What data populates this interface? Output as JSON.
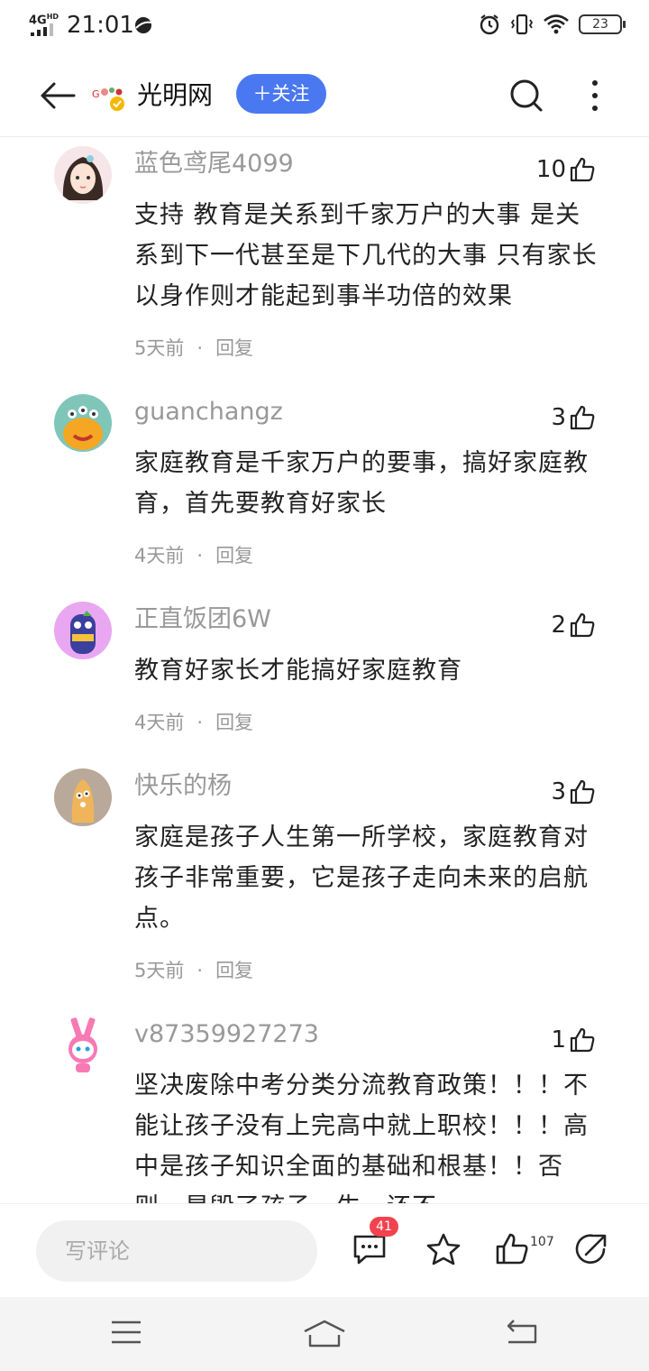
{
  "status_bar": {
    "network": "4G",
    "network_sup": "HD",
    "time": "21:01",
    "battery": "23"
  },
  "header": {
    "back_icon": "arrow-left-icon",
    "channel_name": "光明网",
    "follow_label": "＋关注",
    "search_icon": "search-icon",
    "more_icon": "more-vertical-icon"
  },
  "comments": [
    {
      "user": "蓝色鸢尾4099",
      "likes": "10",
      "text": "支持 教育是关系到千家万户的大事 是关系到下一代甚至是下几代的大事 只有家长以身作则才能起到事半功倍的效果",
      "time": "5天前",
      "reply": "回复",
      "avatar_color": "#f6e6ea"
    },
    {
      "user": "guanchangz",
      "likes": "3",
      "text": "家庭教育是千家万户的要事，搞好家庭教育，首先要教育好家长",
      "time": "4天前",
      "reply": "回复",
      "avatar_color": "#7fc6b9"
    },
    {
      "user": "正直饭团6W",
      "likes": "2",
      "text": "教育好家长才能搞好家庭教育",
      "time": "4天前",
      "reply": "回复",
      "avatar_color": "#e9a7f2"
    },
    {
      "user": "快乐的杨",
      "likes": "3",
      "text": "家庭是孩子人生第一所学校，家庭教育对孩子非常重要，它是孩子走向未来的启航点。",
      "time": "5天前",
      "reply": "回复",
      "avatar_color": "#b8a99a"
    },
    {
      "user": "v87359927273",
      "likes": "1",
      "text": "坚决废除中考分类分流教育政策！！！不能让孩子没有上完高中就上职校！！！高中是孩子知识全面的基础和根基！！否则，是毁了孩子一生，还不",
      "time": "",
      "reply": "",
      "avatar_color": "#ffffff"
    }
  ],
  "action_bar": {
    "comment_placeholder": "写评论",
    "comment_count": "41",
    "like_count": "107"
  },
  "colors": {
    "accent": "#4a78f0",
    "badge": "#f2424f",
    "muted_text": "#999999"
  }
}
